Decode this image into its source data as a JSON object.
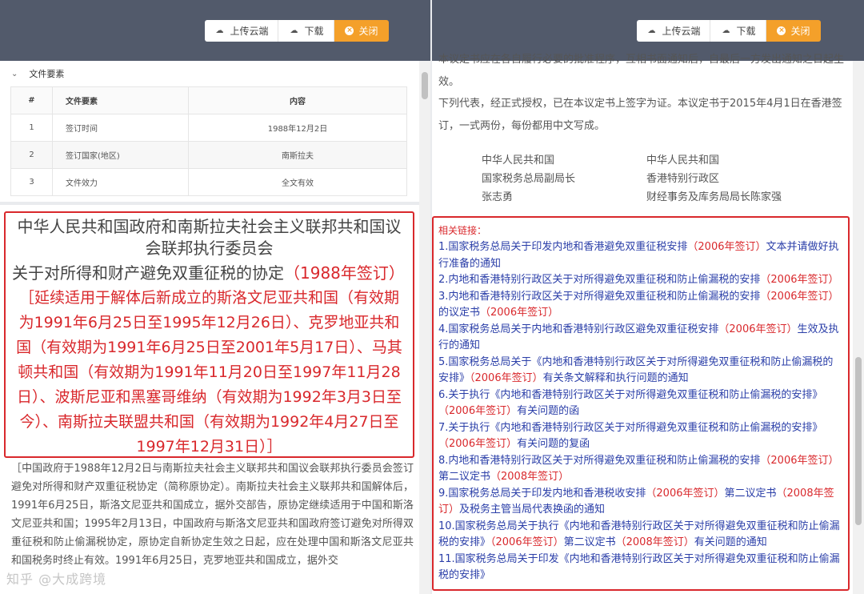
{
  "left": {
    "toolbar": {
      "upload_label": "上传云端",
      "download_label": "下载",
      "close_label": "关闭"
    },
    "section_title": "文件要素",
    "table": {
      "headers": [
        "#",
        "文件要素",
        "内容"
      ],
      "rows": [
        [
          "1",
          "签订时间",
          "1988年12月2日"
        ],
        [
          "2",
          "签订国家(地区)",
          "南斯拉夫"
        ],
        [
          "3",
          "文件效力",
          "全文有效"
        ]
      ]
    },
    "title_line1": "中华人民共和国政府和南斯拉夫社会主义联邦共和国议会联邦执行委员会",
    "title_line2_main": "关于对所得和财产避免双重征税的协定",
    "title_line2_year": "（1988年签订）",
    "title_line3": "［延续适用于解体后新成立的斯洛文尼亚共和国（有效期为1991年6月25日至1995年12月26日）、克罗地亚共和国（有效期为1991年6月25日至2001年5月17日）、马其顿共和国（有效期为1991年11月20日至1997年11月28日）、波斯尼亚和黑塞哥维纳（有效期为1992年3月3日至今）、南斯拉夫联盟共和国（有效期为1992年4月27日至1997年12月31日）］",
    "body": "［中国政府于1988年12月2日与南斯拉夫社会主义联邦共和国议会联邦执行委员会签订避免对所得和财产双重征税协定（简称原协定）。南斯拉夫社会主义联邦共和国解体后，1991年6月25日，斯洛文尼亚共和国成立，据外交部告，原协定继续适用于中国和斯洛文尼亚共和国；1995年2月13日，中国政府与斯洛文尼亚共和国政府签订避免对所得双重征税和防止偷漏税协定，原协定自新协定生效之日起，应在处理中国和斯洛文尼亚共和国税务时终止有效。1991年6月25日，克罗地亚共和国成立，据外交",
    "watermark": "知乎 @大成跨境"
  },
  "right": {
    "toolbar": {
      "upload_label": "上传云端",
      "download_label": "下载",
      "close_label": "关闭"
    },
    "para_top": "本议定书应在各自履行必要的批准程序，互相书面通知后，自最后一方发出通知之日起生效。",
    "para_witness": "下列代表，经正式授权，已在本议定书上签字为证。本议定书于2015年4月1日在香港签订，一式两份，每份都用中文写成。",
    "sig_left": [
      "中华人民共和国",
      "国家税务总局副局长",
      "张志勇"
    ],
    "sig_right": [
      "中华人民共和国",
      "香港特别行政区",
      "财经事务及库务局局长陈家强"
    ],
    "links_title": "相关链接：",
    "links": [
      {
        "a": "1.国家税务总局关于印发内地和香港避免双重征税安排",
        "b": "（2006年签订）",
        "c": "文本并请做好执行准备的通知"
      },
      {
        "a": "2.内地和香港特别行政区关于对所得避免双重征税和防止偷漏税的安排",
        "b": "（2006年签订）",
        "c": ""
      },
      {
        "a": "3.内地和香港特别行政区关于对所得避免双重征税和防止偷漏税的安排",
        "b": "（2006年签订）",
        "c": "的议定书",
        "d": "（2006年签订）"
      },
      {
        "a": "4.国家税务总局关于内地和香港特别行政区避免双重征税安排",
        "b": "（2006年签订）",
        "c": "生效及执行的通知"
      },
      {
        "a": "5.国家税务总局关于《内地和香港特别行政区关于对所得避免双重征税和防止偷漏税的安排》",
        "b": "（2006年签订）",
        "c": "有关条文解释和执行问题的通知"
      },
      {
        "a": "6.关于执行《内地和香港特别行政区关于对所得避免双重征税和防止偷漏税的安排》",
        "b": "（2006年签订）",
        "c": "有关问题的函"
      },
      {
        "a": "7.关于执行《内地和香港特别行政区关于对所得避免双重征税和防止偷漏税的安排》",
        "b": "（2006年签订）",
        "c": "有关问题的复函"
      },
      {
        "a": "8.内地和香港特别行政区关于对所得避免双重征税和防止偷漏税的安排",
        "b": "（2006年签订）",
        "c": "第二议定书",
        "d": "（2008年签订）"
      },
      {
        "a": "9.国家税务总局关于印发内地和香港税收安排",
        "b": "（2006年签订）",
        "c": "第二议定书",
        "d": "（2008年签订）",
        "e": "及税务主管当局代表换函的通知"
      },
      {
        "a": "10.国家税务总局关于执行《内地和香港特别行政区关于对所得避免双重征税和防止偷漏税的安排》",
        "b": "（2006年签订）",
        "c": "第二议定书",
        "d": "（2008年签订）",
        "e": "有关问题的通知"
      },
      {
        "a": "11.国家税务总局关于印发《内地和香港特别行政区关于对所得避免双重征税和防止偷漏税的安排》",
        "b": "",
        "c": ""
      }
    ]
  },
  "colors": {
    "topbar": "#525a6b",
    "accent_orange": "#f4a02a",
    "highlight_red": "#d9282c",
    "link_blue": "#2a3ea8"
  }
}
